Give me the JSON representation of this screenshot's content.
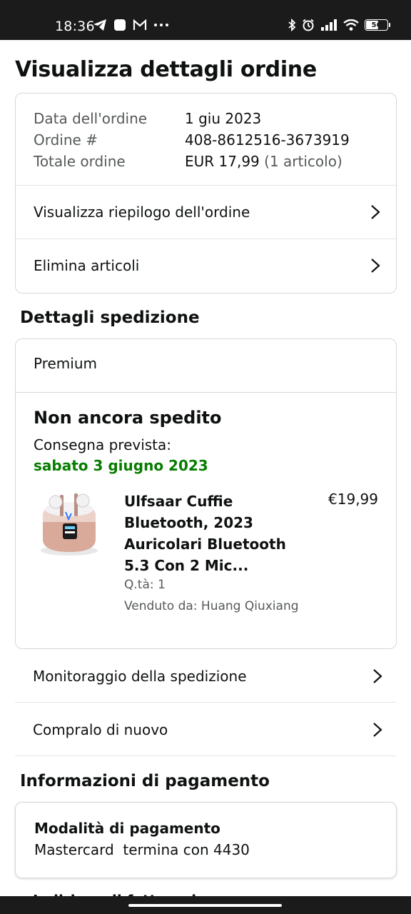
{
  "status_bar": {
    "time": "18:36",
    "battery_level": "56",
    "left_icons": [
      "telegram-icon",
      "app-square-icon",
      "gmail-icon",
      "more-dots-icon"
    ],
    "right_icons": [
      "bluetooth-icon",
      "alarm-icon",
      "signal-icon",
      "wifi-icon",
      "battery-icon"
    ]
  },
  "page": {
    "title": "Visualizza dettagli ordine"
  },
  "order_summary": {
    "date_label": "Data dell'ordine",
    "date_value": "1 giu 2023",
    "number_label": "Ordine #",
    "number_value": "408-8612516-3673919",
    "total_label": "Totale ordine",
    "total_value": "EUR 17,99",
    "total_items": "(1 articolo)",
    "links": [
      {
        "label": "Visualizza riepilogo dell'ordine"
      },
      {
        "label": "Elimina articoli"
      }
    ]
  },
  "shipping": {
    "section_title": "Dettagli spedizione",
    "service": "Premium",
    "status": "Non ancora spedito",
    "eta_label": "Consegna prevista:",
    "eta_date": "sabato 3 giugno 2023",
    "eta_color": "#067d00",
    "item": {
      "title": "Ulfsaar Cuffie Bluetooth, 2023 Auricolari Bluetooth 5.3 Con 2 Mic...",
      "price": "€19,99",
      "qty": "Q.tà: 1",
      "seller": "Venduto da: Huang Qiuxiang"
    }
  },
  "actions": [
    {
      "label": "Monitoraggio della spedizione"
    },
    {
      "label": "Compralo di nuovo"
    }
  ],
  "payment": {
    "section_title": "Informazioni di pagamento",
    "method_label": "Modalità di pagamento",
    "method_value": "Mastercard  termina con 4430",
    "next_section_partial": "Indirizzo di fatturazione"
  }
}
